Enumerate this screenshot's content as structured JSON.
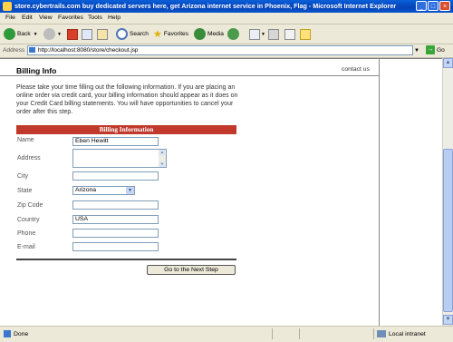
{
  "window": {
    "title": "store.cybertrails.com buy dedicated servers here, get Arizona internet service in Phoenix, Flag - Microsoft Internet Explorer"
  },
  "menu": [
    "File",
    "Edit",
    "View",
    "Favorites",
    "Tools",
    "Help"
  ],
  "toolbar": {
    "back": "Back",
    "search": "Search",
    "favorites": "Favorites",
    "media": "Media"
  },
  "address": {
    "label": "Address",
    "url": "http://localhost:8080/store/checkout.jsp",
    "go": "Go"
  },
  "page": {
    "heading": "Billing Info",
    "contact_link": "contact us",
    "intro": "Please take your time filling out the following information. If you are placing an online order via credit card, your billing information should appear as it does on your Credit Card billing statements. You will have opportunities to cancel your order after this step.",
    "section_title": "Billing Information",
    "fields": {
      "name": {
        "label": "Name",
        "value": "Eben Hewitt"
      },
      "address": {
        "label": "Address",
        "value": ""
      },
      "city": {
        "label": "City",
        "value": ""
      },
      "state": {
        "label": "State",
        "value": "Arizona"
      },
      "zip": {
        "label": "Zip Code",
        "value": ""
      },
      "country": {
        "label": "Country",
        "value": "USA"
      },
      "phone": {
        "label": "Phone",
        "value": ""
      },
      "email": {
        "label": "E-mail",
        "value": ""
      }
    },
    "next_button": "Go to the Next Step"
  },
  "status": {
    "text": "Done",
    "zone": "Local intranet"
  },
  "colors": {
    "section_bar": "#c0392b",
    "titlebar": "#0a56cf"
  }
}
